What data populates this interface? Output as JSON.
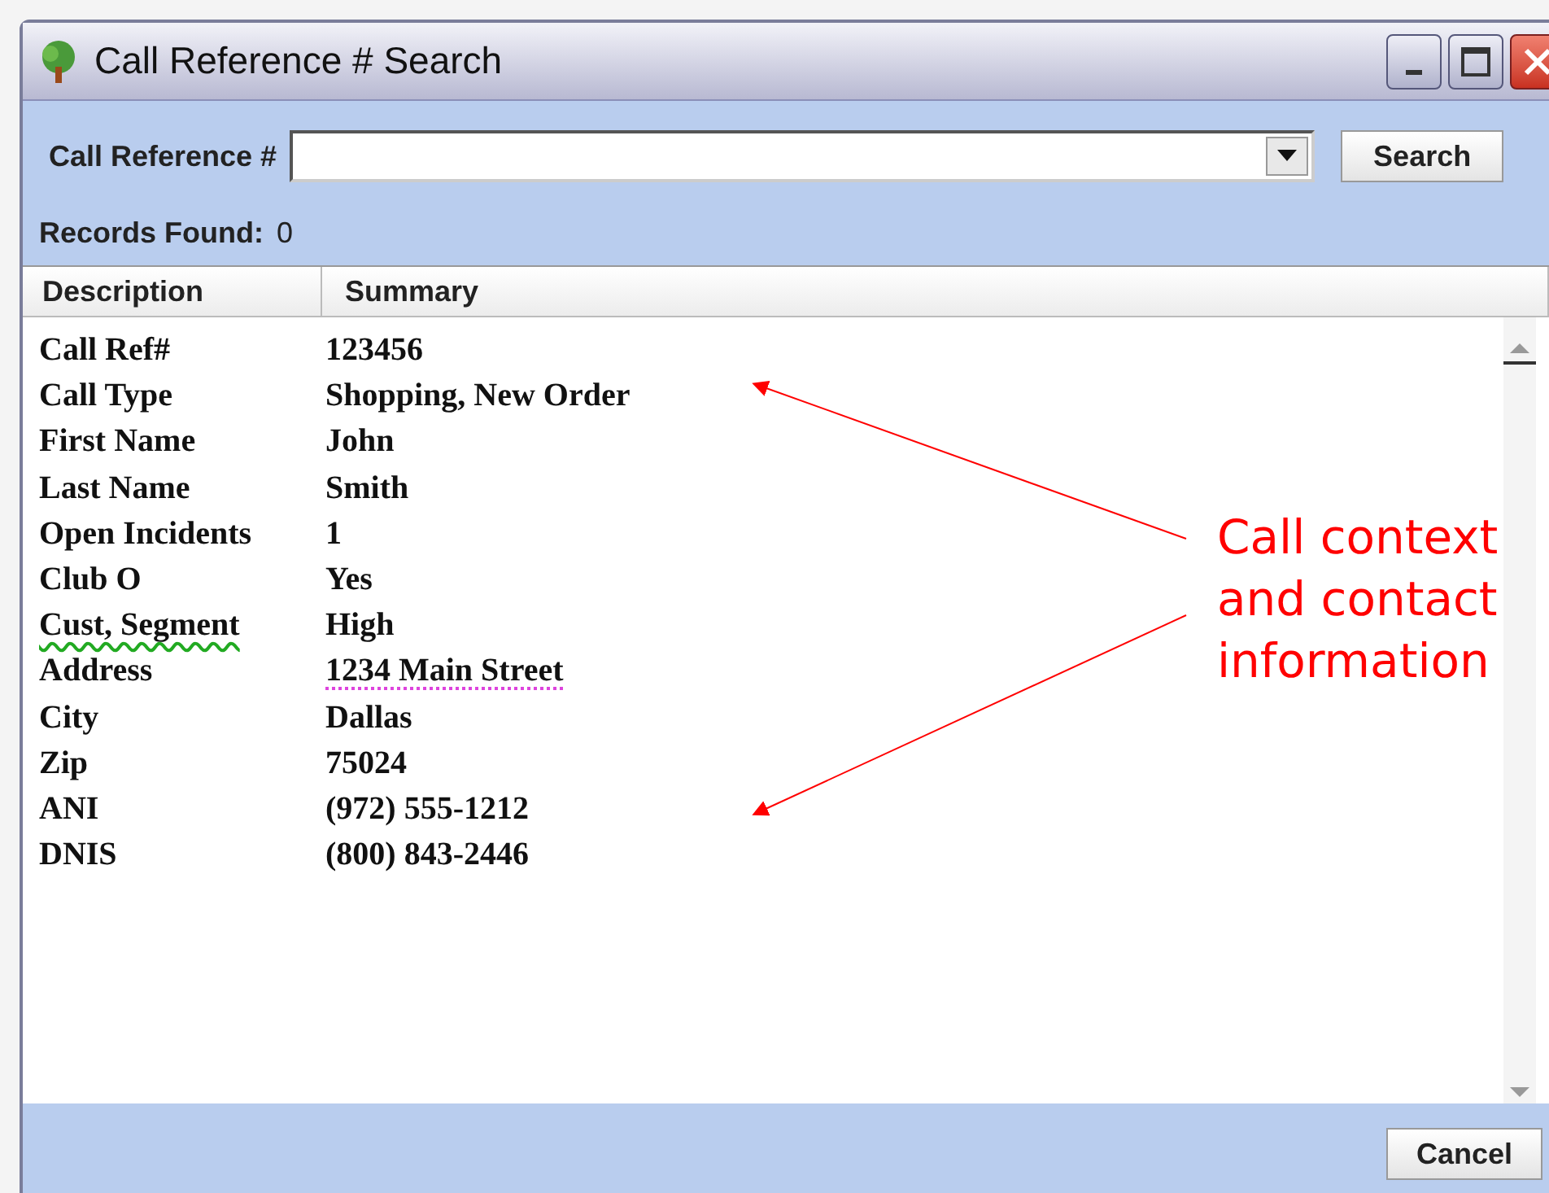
{
  "window": {
    "title": "Call Reference # Search"
  },
  "search": {
    "label": "Call Reference #",
    "button": "Search"
  },
  "records_found": {
    "label": "Records Found:",
    "count": "0"
  },
  "table": {
    "columns": [
      "Description",
      "Summary"
    ],
    "rows": [
      {
        "description": "Call Ref#",
        "summary": "123456"
      },
      {
        "description": "Call Type",
        "summary": "Shopping, New Order"
      },
      {
        "description": "First Name",
        "summary": "John"
      },
      {
        "description": "Last Name",
        "summary": "Smith"
      },
      {
        "description": "Open Incidents",
        "summary": "1"
      },
      {
        "description": "Club O",
        "summary": "Yes"
      },
      {
        "description": "Cust, Segment",
        "summary": "High",
        "description_flagged": true
      },
      {
        "description": "Address",
        "summary": "1234 Main Street",
        "summary_tagged": true
      },
      {
        "description": "City",
        "summary": "Dallas"
      },
      {
        "description": "Zip",
        "summary": "75024"
      },
      {
        "description": "ANI",
        "summary": "(972) 555-1212"
      },
      {
        "description": "DNIS",
        "summary": "(800) 843-2446"
      }
    ]
  },
  "annotation": {
    "lines": [
      "Call context",
      "and contact",
      "information"
    ]
  },
  "footer": {
    "button": "Cancel"
  }
}
